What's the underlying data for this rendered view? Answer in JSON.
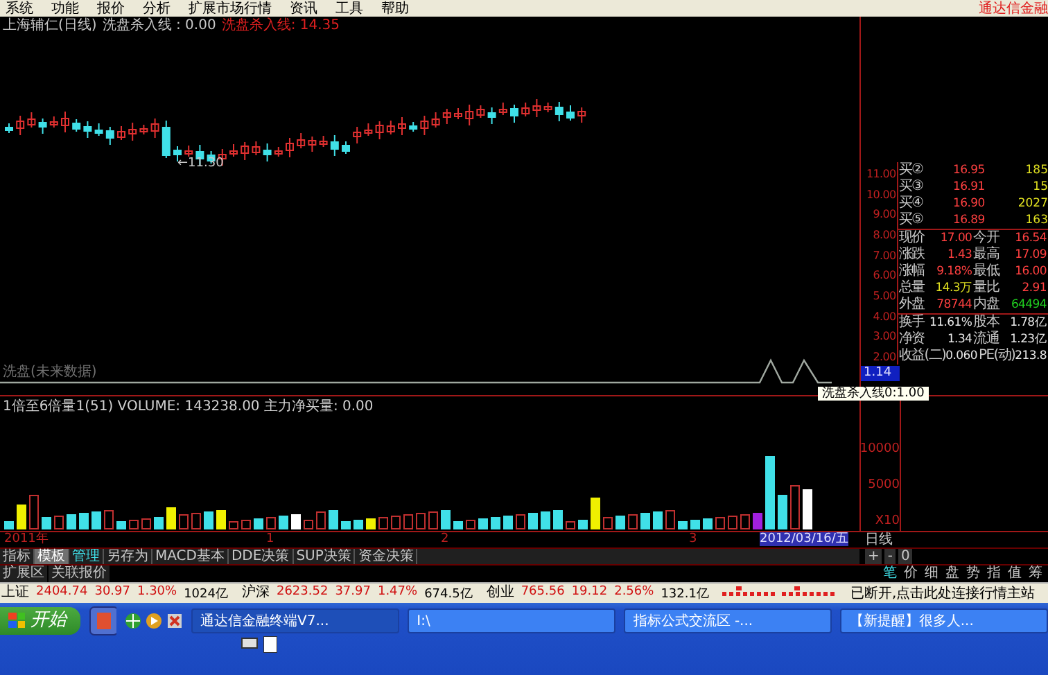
{
  "menu": [
    "系统",
    "功能",
    "报价",
    "分析",
    "扩展市场行情",
    "资讯",
    "工具",
    "帮助"
  ],
  "brand": "通达信金融",
  "chart_title": {
    "stock": "上海辅仁(日线)",
    "indicator": "洗盘杀入线 : 0.00",
    "signal": "洗盘杀入线: 14.35"
  },
  "price_marker": "←11.30",
  "price_axis": [
    "11.00",
    "10.00",
    "9.00",
    "8.00",
    "7.00",
    "6.00",
    "5.00",
    "4.00",
    "3.00",
    "2.00"
  ],
  "order_book": [
    {
      "label": "买②",
      "price": "16.95",
      "volume": "185"
    },
    {
      "label": "买③",
      "price": "16.91",
      "volume": "15"
    },
    {
      "label": "买④",
      "price": "16.90",
      "volume": "2027"
    },
    {
      "label": "买⑤",
      "price": "16.89",
      "volume": "163"
    }
  ],
  "quote_rows": [
    [
      {
        "label": "现价",
        "value": "17.00",
        "color": "#ff4040"
      },
      {
        "label": "今开",
        "value": "16.54",
        "color": "#ff4040"
      }
    ],
    [
      {
        "label": "涨跌",
        "value": "1.43",
        "color": "#ff4040"
      },
      {
        "label": "最高",
        "value": "17.09",
        "color": "#ff4040"
      }
    ],
    [
      {
        "label": "涨幅",
        "value": "9.18%",
        "color": "#ff4040"
      },
      {
        "label": "最低",
        "value": "16.00",
        "color": "#ff4040"
      }
    ],
    [
      {
        "label": "总量",
        "value": "14.3万",
        "color": "#e0e020"
      },
      {
        "label": "量比",
        "value": "2.91",
        "color": "#ff4040"
      }
    ],
    [
      {
        "label": "外盘",
        "value": "78744",
        "color": "#ff4040"
      },
      {
        "label": "内盘",
        "value": "64494",
        "color": "#20d020"
      }
    ]
  ],
  "fundamentals": [
    [
      {
        "label": "换手",
        "value": "11.61%"
      },
      {
        "label": "股本",
        "value": "1.78亿"
      }
    ],
    [
      {
        "label": "净资",
        "value": "1.34"
      },
      {
        "label": "流通",
        "value": "1.23亿"
      }
    ],
    [
      {
        "label": "收益(二)",
        "value": "0.060"
      },
      {
        "label": "PE(动)",
        "value": "213.8"
      }
    ]
  ],
  "current_marker": "1.14",
  "line_label": "洗盘(未来数据)",
  "line_tooltip": "洗盘杀入线0:1.00",
  "volume_title": "1倍至6倍量1(51) VOLUME: 143238.00 主力净买量: 0.00",
  "volume_axis": [
    "10000",
    "5000",
    "X10"
  ],
  "date_axis": [
    {
      "label": "2011年",
      "selected": false
    },
    {
      "label": "1",
      "selected": false
    },
    {
      "label": "2",
      "selected": false
    },
    {
      "label": "3",
      "selected": false
    },
    {
      "label": "2012/03/16/五",
      "selected": true
    }
  ],
  "period": "日线",
  "tabs": [
    {
      "label": "指标",
      "selected": false,
      "highlighted": false
    },
    {
      "label": "模板",
      "selected": true,
      "highlighted": false
    },
    {
      "label": "管理",
      "selected": false,
      "highlighted": true
    },
    {
      "label": "另存为",
      "selected": false,
      "highlighted": false
    },
    {
      "label": "MACD基本",
      "selected": false,
      "highlighted": false
    },
    {
      "label": "DDE决策",
      "selected": false,
      "highlighted": false
    },
    {
      "label": "SUP决策",
      "selected": false,
      "highlighted": false
    },
    {
      "label": "资金决策",
      "selected": false,
      "highlighted": false
    }
  ],
  "zoom_buttons": [
    "+",
    "-",
    "0"
  ],
  "ext_tabs": [
    "扩展区",
    "关联报价"
  ],
  "side_tabs": [
    {
      "label": "笔",
      "selected": true
    },
    {
      "label": "价",
      "selected": false
    },
    {
      "label": "细",
      "selected": false
    },
    {
      "label": "盘",
      "selected": false
    },
    {
      "label": "势",
      "selected": false
    },
    {
      "label": "指",
      "selected": false
    },
    {
      "label": "值",
      "selected": false
    },
    {
      "label": "筹",
      "selected": false
    }
  ],
  "indices": [
    {
      "name": "上证",
      "value": "2404.74",
      "change": "30.97",
      "pct": "1.30%",
      "amount": "1024亿"
    },
    {
      "name": "沪深",
      "value": "2623.52",
      "change": "37.97",
      "pct": "1.47%",
      "amount": "674.5亿"
    },
    {
      "name": "创业",
      "value": "765.56",
      "change": "19.12",
      "pct": "2.56%",
      "amount": "132.1亿"
    }
  ],
  "status_message": "已断开,点击此处连接行情主站",
  "taskbar": {
    "start": "开始",
    "tasks": [
      {
        "label": "通达信金融终端V7...",
        "selected": true
      },
      {
        "label": "I:\\",
        "selected": false
      },
      {
        "label": "指标公式交流区 -...",
        "selected": false
      },
      {
        "label": "【新提醒】很多人...",
        "selected": false
      }
    ]
  }
}
